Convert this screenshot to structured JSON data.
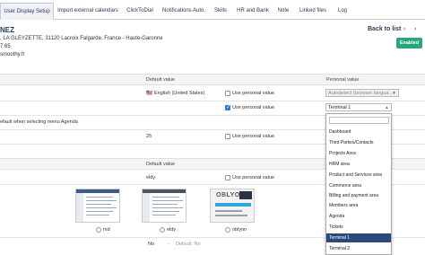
{
  "tabs": [
    {
      "label": "User Display Setup",
      "active": true
    },
    {
      "label": "Import external calendars"
    },
    {
      "label": "ClickToDial"
    },
    {
      "label": "Notifications Auto."
    },
    {
      "label": "Skills"
    },
    {
      "label": "HR and Bank"
    },
    {
      "label": "Note"
    },
    {
      "label": "Linked files"
    },
    {
      "label": "Log"
    }
  ],
  "header": {
    "name_fragment": "NEZ",
    "address": ", LA GLEYZETTE, 31120 Lacroix Falgarde, France - Haute-Garonne",
    "phone": "7 65",
    "website": "smoothy.fr",
    "back_label": "Back to list",
    "status_badge": "Enabled"
  },
  "section1": {
    "col_default": "Default value",
    "col_personal": "Personal value",
    "rows": [
      {
        "label": "",
        "default": "English (United States)",
        "checkbox_label": "Use personal value",
        "checked": false,
        "personal": "Autodetect (browser langua..."
      },
      {
        "label": "efault when selecting menu Agenda",
        "default": "",
        "checkbox_label": "Use personal value",
        "checked": true,
        "personal": "Terminal 1"
      },
      {
        "label": "",
        "default": "25",
        "checkbox_label": "Use personal value",
        "checked": false,
        "personal": ""
      }
    ]
  },
  "section2": {
    "col_default": "Default value",
    "theme_default": "eldy",
    "checkbox_label": "Use personal value",
    "themes": [
      {
        "name": "md"
      },
      {
        "name": "eldy"
      },
      {
        "name": "oblyon",
        "logo_text": "OBLYON"
      }
    ],
    "last_row": {
      "value": "No",
      "dash": "-",
      "default_label": "Default: No"
    }
  },
  "dropdown": {
    "items": [
      "Dashboard",
      "Third Parties/Contacts",
      "Projects Area",
      "HRM area",
      "Product and Services area",
      "Commerce area",
      "Billing and payment area",
      "Members area",
      "Agenda",
      "Tickets",
      "Terminal 1",
      "Terminal 2"
    ],
    "selected": "Terminal 1"
  },
  "colors": {
    "accent": "#263c5c",
    "badge": "#25a580",
    "selected_item": "#2a4a7c"
  }
}
